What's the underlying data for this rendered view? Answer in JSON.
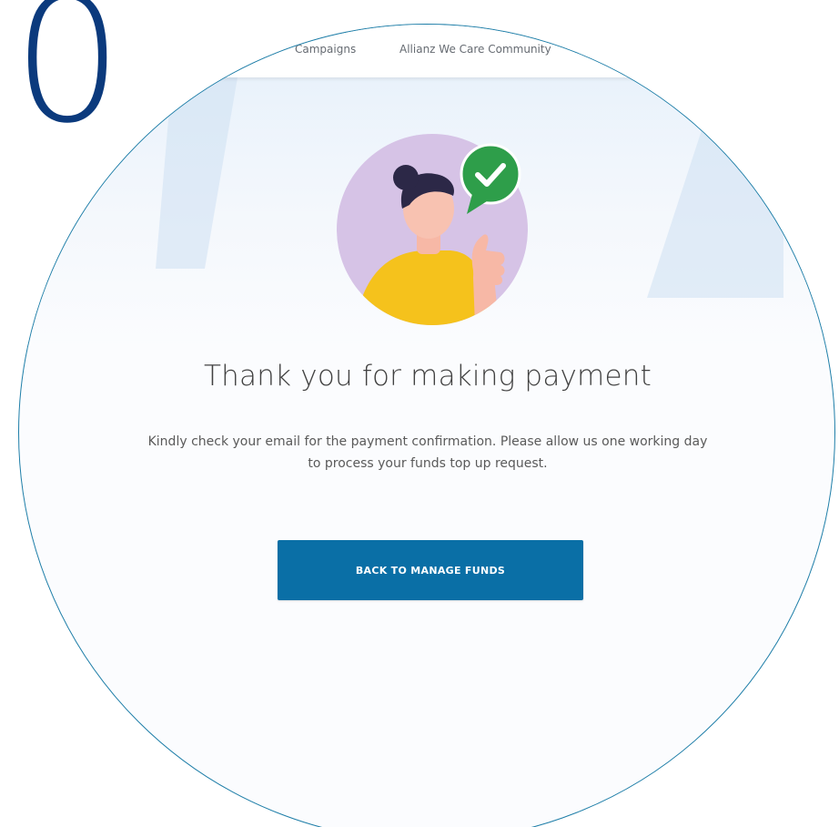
{
  "nav": {
    "links": [
      "Campaigns",
      "Allianz We Care Community"
    ]
  },
  "confirmation": {
    "title": "Thank you for making payment",
    "message_line_1": "Kindly check your email for the payment confirmation. Please allow us one working day",
    "message_line_2": "to process your funds top up request.",
    "button_label": "BACK TO MANAGE FUNDS"
  },
  "step": {
    "numeral": "0"
  },
  "colors": {
    "primary_button": "#0a6fa6",
    "badge_green": "#2e9e4a",
    "avatar_circle": "#d6c3e6",
    "shirt_yellow": "#f5c21c",
    "numeral_navy": "#0b3a7d",
    "lens_border": "#1e7ea8"
  },
  "icons": {
    "badge": "checkmark-chat-bubble-icon",
    "hero": "person-thumbs-up-illustration"
  }
}
